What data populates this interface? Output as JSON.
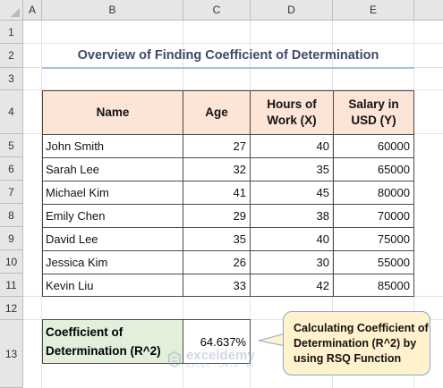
{
  "columns": [
    "A",
    "B",
    "C",
    "D",
    "E"
  ],
  "rows": [
    "1",
    "2",
    "3",
    "4",
    "5",
    "6",
    "7",
    "8",
    "9",
    "10",
    "11",
    "12",
    "13"
  ],
  "title": "Overview of Finding Coefficient of Determination",
  "table": {
    "headers": {
      "name": "Name",
      "age": "Age",
      "hours": "Hours of Work (X)",
      "salary": "Salary in USD (Y)"
    },
    "data": [
      {
        "name": "John Smith",
        "age": "27",
        "hours": "40",
        "salary": "60000"
      },
      {
        "name": "Sarah Lee",
        "age": "32",
        "hours": "35",
        "salary": "65000"
      },
      {
        "name": "Michael Kim",
        "age": "41",
        "hours": "45",
        "salary": "80000"
      },
      {
        "name": "Emily Chen",
        "age": "29",
        "hours": "38",
        "salary": "70000"
      },
      {
        "name": "David Lee",
        "age": "35",
        "hours": "40",
        "salary": "75000"
      },
      {
        "name": "Jessica Kim",
        "age": "26",
        "hours": "30",
        "salary": "55000"
      },
      {
        "name": "Kevin Liu",
        "age": "33",
        "hours": "42",
        "salary": "85000"
      }
    ]
  },
  "coefficient": {
    "label": "Coefficient of Determination (R^2)",
    "value": "64.637%"
  },
  "callout": "Calculating Coefficient of Determination (R^2) by using RSQ Function",
  "watermark": {
    "name": "exceldemy",
    "tagline": "EXCEL · DATA · BI"
  },
  "colors": {
    "header_fill": "#fce4d6",
    "coef_fill": "#e2efda",
    "callout_fill": "#fff2cc",
    "title_underline": "#9dc3e6"
  }
}
